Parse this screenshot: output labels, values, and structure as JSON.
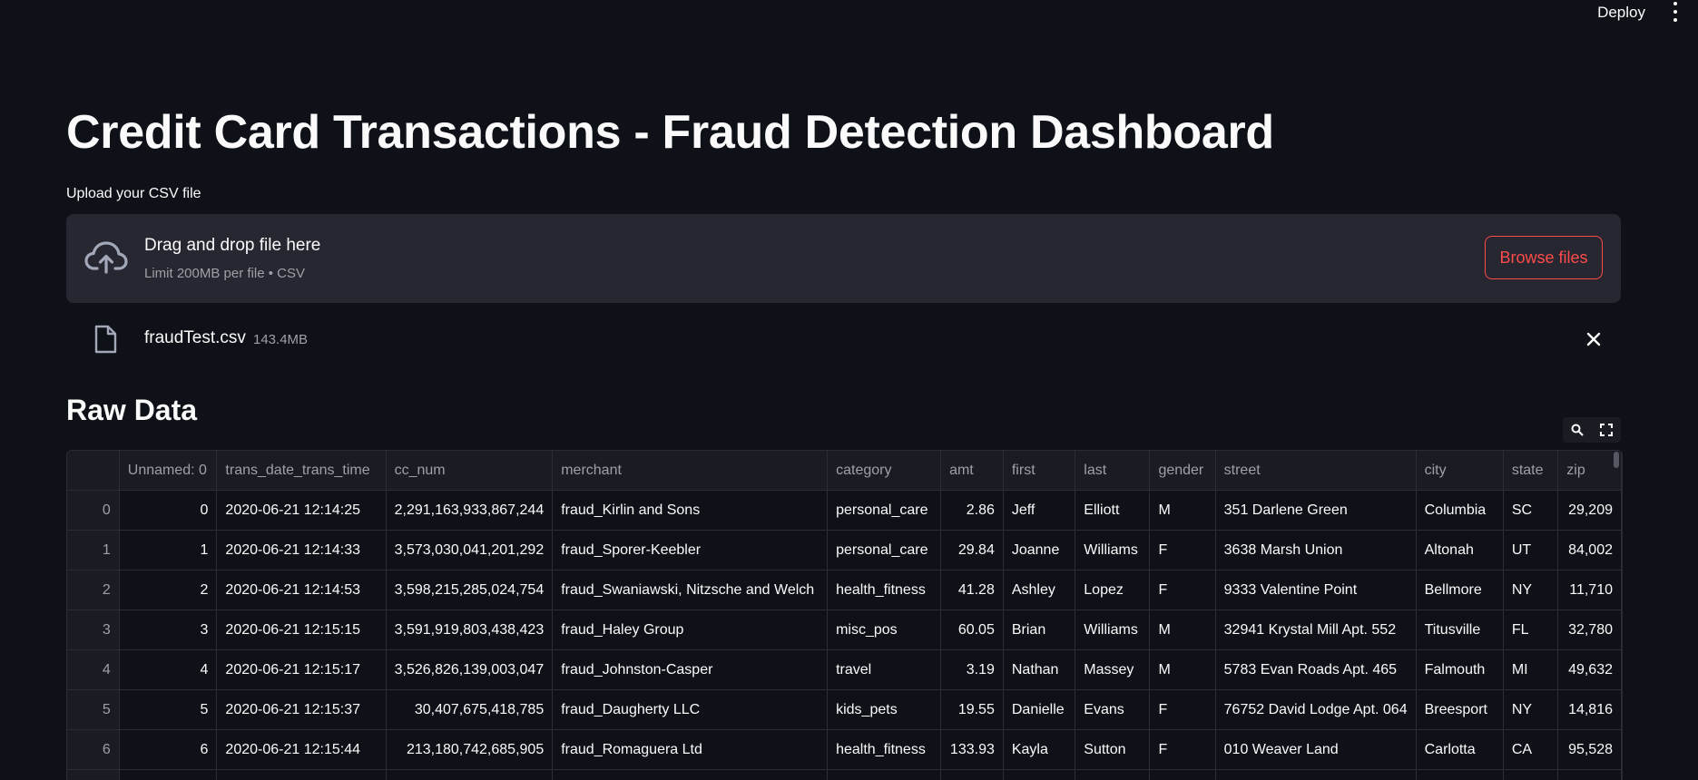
{
  "header": {
    "deploy_label": "Deploy"
  },
  "page": {
    "title": "Credit Card Transactions - Fraud Detection Dashboard"
  },
  "uploader": {
    "label": "Upload your CSV file",
    "drop_text": "Drag and drop file here",
    "limit_text": "Limit 200MB per file • CSV",
    "browse_label": "Browse files",
    "file_name": "fraudTest.csv",
    "file_size": "143.4MB"
  },
  "raw_data": {
    "heading": "Raw Data",
    "columns": [
      "",
      "Unnamed: 0",
      "trans_date_trans_time",
      "cc_num",
      "merchant",
      "category",
      "amt",
      "first",
      "last",
      "gender",
      "street",
      "city",
      "state",
      "zip"
    ],
    "rows": [
      [
        "0",
        "0",
        "2020-06-21 12:14:25",
        "2,291,163,933,867,244",
        "fraud_Kirlin and Sons",
        "personal_care",
        "2.86",
        "Jeff",
        "Elliott",
        "M",
        "351 Darlene Green",
        "Columbia",
        "SC",
        "29,209"
      ],
      [
        "1",
        "1",
        "2020-06-21 12:14:33",
        "3,573,030,041,201,292",
        "fraud_Sporer-Keebler",
        "personal_care",
        "29.84",
        "Joanne",
        "Williams",
        "F",
        "3638 Marsh Union",
        "Altonah",
        "UT",
        "84,002"
      ],
      [
        "2",
        "2",
        "2020-06-21 12:14:53",
        "3,598,215,285,024,754",
        "fraud_Swaniawski, Nitzsche and Welch",
        "health_fitness",
        "41.28",
        "Ashley",
        "Lopez",
        "F",
        "9333 Valentine Point",
        "Bellmore",
        "NY",
        "11,710"
      ],
      [
        "3",
        "3",
        "2020-06-21 12:15:15",
        "3,591,919,803,438,423",
        "fraud_Haley Group",
        "misc_pos",
        "60.05",
        "Brian",
        "Williams",
        "M",
        "32941 Krystal Mill Apt. 552",
        "Titusville",
        "FL",
        "32,780"
      ],
      [
        "4",
        "4",
        "2020-06-21 12:15:17",
        "3,526,826,139,003,047",
        "fraud_Johnston-Casper",
        "travel",
        "3.19",
        "Nathan",
        "Massey",
        "M",
        "5783 Evan Roads Apt. 465",
        "Falmouth",
        "MI",
        "49,632"
      ],
      [
        "5",
        "5",
        "2020-06-21 12:15:37",
        "30,407,675,418,785",
        "fraud_Daugherty LLC",
        "kids_pets",
        "19.55",
        "Danielle",
        "Evans",
        "F",
        "76752 David Lodge Apt. 064",
        "Breesport",
        "NY",
        "14,816"
      ],
      [
        "6",
        "6",
        "2020-06-21 12:15:44",
        "213,180,742,685,905",
        "fraud_Romaguera Ltd",
        "health_fitness",
        "133.93",
        "Kayla",
        "Sutton",
        "F",
        "010 Weaver Land",
        "Carlotta",
        "CA",
        "95,528"
      ],
      [
        "",
        "",
        "",
        "",
        "",
        "",
        "",
        "",
        "",
        "",
        "",
        "",
        "",
        ""
      ]
    ]
  }
}
